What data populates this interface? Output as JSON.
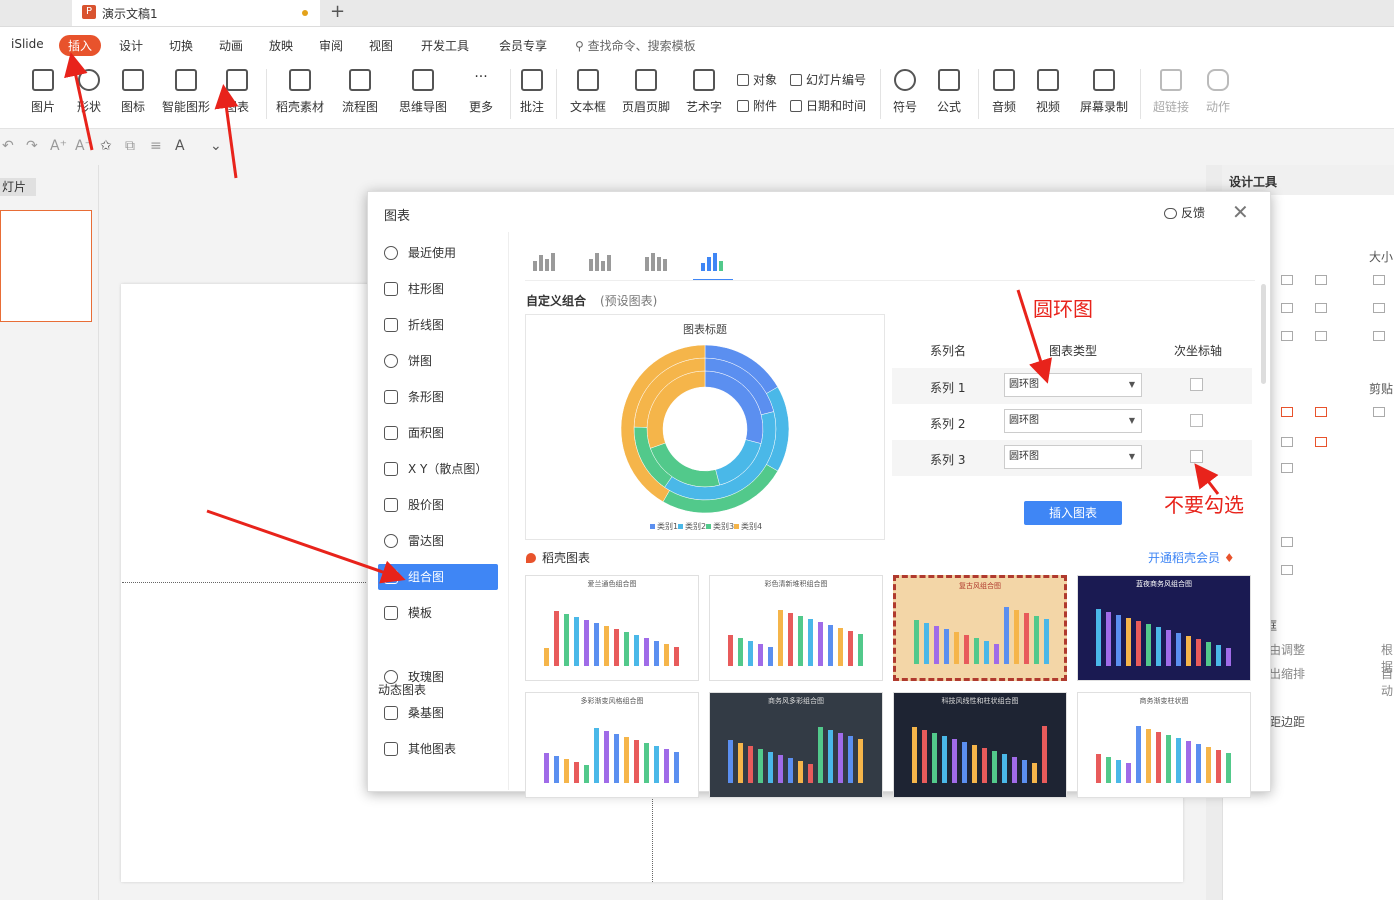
{
  "window": {
    "doc_tab": "演示文稿1",
    "new_tab": "+"
  },
  "menu": {
    "items": [
      "iSlide",
      "插入",
      "设计",
      "切换",
      "动画",
      "放映",
      "审阅",
      "视图",
      "开发工具",
      "会员专享"
    ],
    "search": "查找命令、搜索模板"
  },
  "ribbon": {
    "picture": "图片",
    "shape": "形状",
    "icon": "图标",
    "smartart": "智能图形",
    "chart": "图表",
    "material": "稻壳素材",
    "flowchart": "流程图",
    "mindmap": "思维导图",
    "more": "更多",
    "comment": "批注",
    "textbox": "文本框",
    "header_footer": "页眉页脚",
    "wordart": "艺术字",
    "object": "对象",
    "slide_number": "幻灯片编号",
    "attachment": "附件",
    "datetime": "日期和时间",
    "symbol": "符号",
    "formula": "公式",
    "audio": "音频",
    "video": "视频",
    "screen_record": "屏幕录制",
    "hyperlink": "超链接",
    "action": "动作"
  },
  "left_panel": {
    "slides_label": "灯片"
  },
  "right_panel": {
    "title": "设计工具",
    "size": "大小",
    "paste": "剪贴",
    "auto_adjust": "由调整",
    "shrink": "出缩排",
    "root": "根据",
    "auto": "自动",
    "margin": "距边距",
    "margin_prefix": "框"
  },
  "dialog": {
    "title": "图表",
    "feedback": "反馈",
    "close": "✕",
    "categories": [
      "最近使用",
      "柱形图",
      "折线图",
      "饼图",
      "条形图",
      "面积图",
      "X Y（散点图）",
      "股价图",
      "雷达图",
      "组合图",
      "模板"
    ],
    "dynamic_label": "动态图表",
    "dynamic_categories": [
      "玫瑰图",
      "桑基图",
      "其他图表"
    ],
    "selected_category": "组合图",
    "custom_title": "自定义组合",
    "custom_sub": "(预设图表)",
    "preview_chart_title": "图表标题",
    "legend": [
      "类别1",
      "类别2",
      "类别3",
      "类别4"
    ],
    "table_headers": {
      "name": "系列名",
      "type": "图表类型",
      "secondary": "次坐标轴"
    },
    "series": [
      {
        "name": "系列 1",
        "type": "圆环图",
        "secondary": false
      },
      {
        "name": "系列 2",
        "type": "圆环图",
        "secondary": false
      },
      {
        "name": "系列 3",
        "type": "圆环图",
        "secondary": false
      }
    ],
    "insert_button": "插入图表",
    "daoke_title": "稻壳图表",
    "member_link": "开通稻壳会员",
    "templates": [
      {
        "title": "爱兰通色组合图",
        "bg": "#ffffff",
        "fg": "#555555"
      },
      {
        "title": "彩色清新堆积组合图",
        "bg": "#ffffff",
        "fg": "#555555"
      },
      {
        "title": "复古风组合图",
        "bg": "#f3d6a7",
        "fg": "#b03a2e"
      },
      {
        "title": "蓝夜商务风组合图",
        "bg": "#1a1a52",
        "fg": "#ffffff"
      },
      {
        "title": "多彩渐变风格组合图",
        "bg": "#ffffff",
        "fg": "#555555"
      },
      {
        "title": "商务风多彩组合图",
        "bg": "#333b45",
        "fg": "#dddddd"
      },
      {
        "title": "科技风线性和柱状组合图",
        "bg": "#1e2433",
        "fg": "#dddddd"
      },
      {
        "title": "商务渐变柱状图",
        "bg": "#ffffff",
        "fg": "#555555"
      }
    ]
  },
  "annotations": {
    "donut_label": "圆环图",
    "no_check": "不要勾选"
  },
  "colors": {
    "accent": "#e8532c",
    "primary": "#3f86f5",
    "annotation": "#e8231b",
    "series": [
      "#5b8ff0",
      "#4ab8e8",
      "#52c98b",
      "#f5b54a"
    ]
  },
  "chart_data": {
    "type": "donut",
    "title": "图表标题",
    "categories": [
      "类别1",
      "类别2",
      "类别3",
      "类别4"
    ],
    "series": [
      {
        "values": [
          4.3,
          2.5,
          3.5,
          4.5
        ]
      },
      {
        "values": [
          2.4,
          4.4,
          1.8,
          2.8
        ]
      },
      {
        "values": [
          2,
          2,
          3,
          5
        ]
      }
    ]
  }
}
